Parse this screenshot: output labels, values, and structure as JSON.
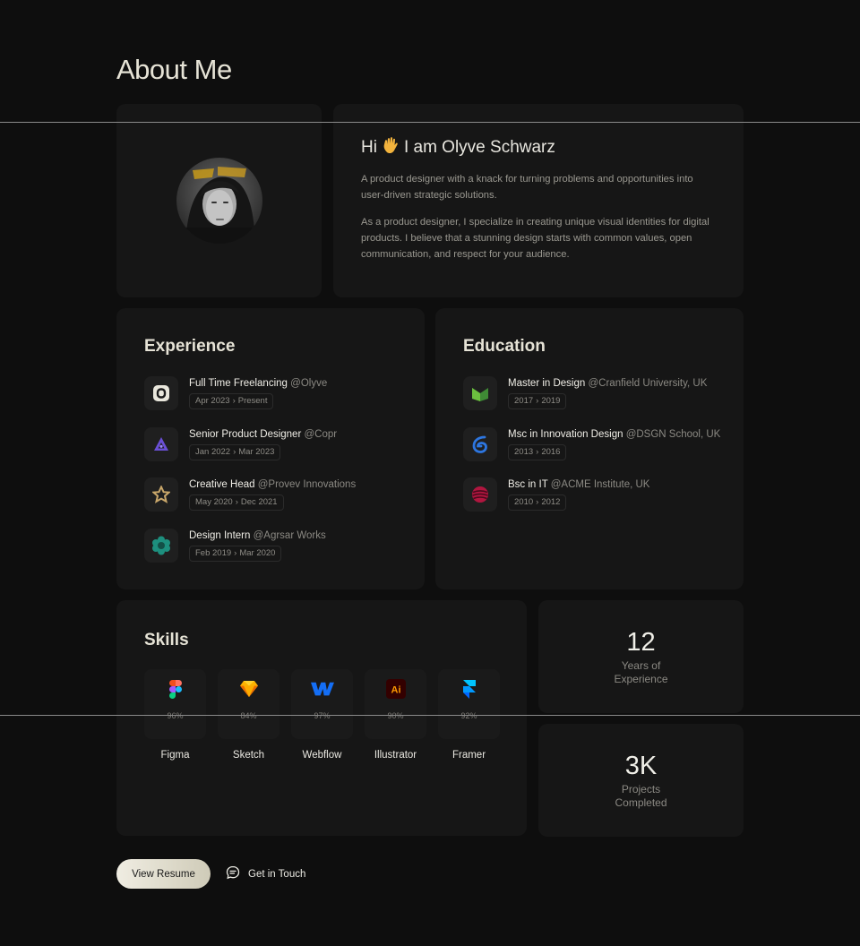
{
  "page": {
    "title": "About Me"
  },
  "intro": {
    "greeting_before": "Hi",
    "greeting_after": "I am Olyve Schwarz",
    "wave_icon": "waving-hand-icon",
    "bio_1": "A product designer with a knack for turning problems and opportunities into user-driven strategic solutions.",
    "bio_2": "As a product designer, I specialize in creating unique visual identities for digital products. I believe that a stunning design starts with common values, open communication, and respect for your audience."
  },
  "experience": {
    "title": "Experience",
    "items": [
      {
        "role": "Full Time Freelancing",
        "org": "@Olyve",
        "start": "Apr 2023",
        "end": "Present",
        "logo": "olyve-logo-icon"
      },
      {
        "role": "Senior Product Designer",
        "org": "@Copr",
        "start": "Jan 2022",
        "end": "Mar 2023",
        "logo": "copr-logo-icon"
      },
      {
        "role": "Creative Head",
        "org": "@Provev Innovations",
        "start": "May 2020",
        "end": "Dec 2021",
        "logo": "provev-logo-icon"
      },
      {
        "role": "Design Intern",
        "org": "@Agrsar Works",
        "start": "Feb 2019",
        "end": "Mar 2020",
        "logo": "agrsar-logo-icon"
      }
    ]
  },
  "education": {
    "title": "Education",
    "items": [
      {
        "role": "Master in Design",
        "org": "@Cranfield University, UK",
        "start": "2017",
        "end": "2019",
        "logo": "cranfield-logo-icon"
      },
      {
        "role": "Msc in Innovation Design",
        "org": "@DSGN School, UK",
        "start": "2013",
        "end": "2016",
        "logo": "dsgn-logo-icon"
      },
      {
        "role": "Bsc in IT",
        "org": "@ACME Institute, UK",
        "start": "2010",
        "end": "2012",
        "logo": "acme-logo-icon"
      }
    ]
  },
  "skills": {
    "title": "Skills",
    "items": [
      {
        "name": "Figma",
        "percent": "96%",
        "icon": "figma-icon"
      },
      {
        "name": "Sketch",
        "percent": "84%",
        "icon": "sketch-icon"
      },
      {
        "name": "Webflow",
        "percent": "97%",
        "icon": "webflow-icon"
      },
      {
        "name": "Illustrator",
        "percent": "90%",
        "icon": "illustrator-icon",
        "icon_text": "Ai"
      },
      {
        "name": "Framer",
        "percent": "92%",
        "icon": "framer-icon"
      }
    ]
  },
  "stats": {
    "years": {
      "value": "12",
      "label": "Years of Experience"
    },
    "projects": {
      "value": "3K",
      "label": "Projects Completed"
    }
  },
  "actions": {
    "resume_label": "View Resume",
    "touch_label": "Get in Touch",
    "touch_icon": "chat-bubble-icon"
  },
  "colors": {
    "background": "#0e0e0e",
    "card": "#161616",
    "accent": "#f2b33d",
    "button": "#e8e5d8"
  }
}
